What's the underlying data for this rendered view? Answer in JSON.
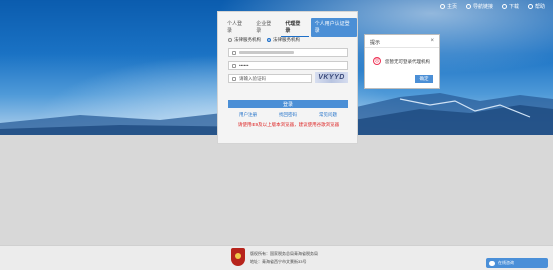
{
  "nav": {
    "home": "主页",
    "nav_links": "导航链接",
    "download": "下载",
    "help": "帮助"
  },
  "login": {
    "tabs": [
      "个人登录",
      "企业登录",
      "代理登录"
    ],
    "tab_button": "个人用户认证登录",
    "radio_options": [
      "法律服务机构",
      "法律服务机构"
    ],
    "username_placeholder": "",
    "password_value": "••••••",
    "captcha_placeholder": "请输入验证码",
    "captcha_text": "VKYYD",
    "login_button": "登录",
    "links": [
      "用户注册",
      "找回密码",
      "常见问题"
    ],
    "warning": "请使用IE9及以上版本浏览器，建议使用谷歌浏览器"
  },
  "dialog": {
    "title": "提示",
    "close": "×",
    "icon": "☹",
    "message": "您暂无可登录代理机构",
    "ok": "确定"
  },
  "footer": {
    "line1": "版权所有：国家税务总局青海省税务局",
    "line2": "地址：青海省西宁市文景街33号",
    "chat": "在线咨询"
  }
}
